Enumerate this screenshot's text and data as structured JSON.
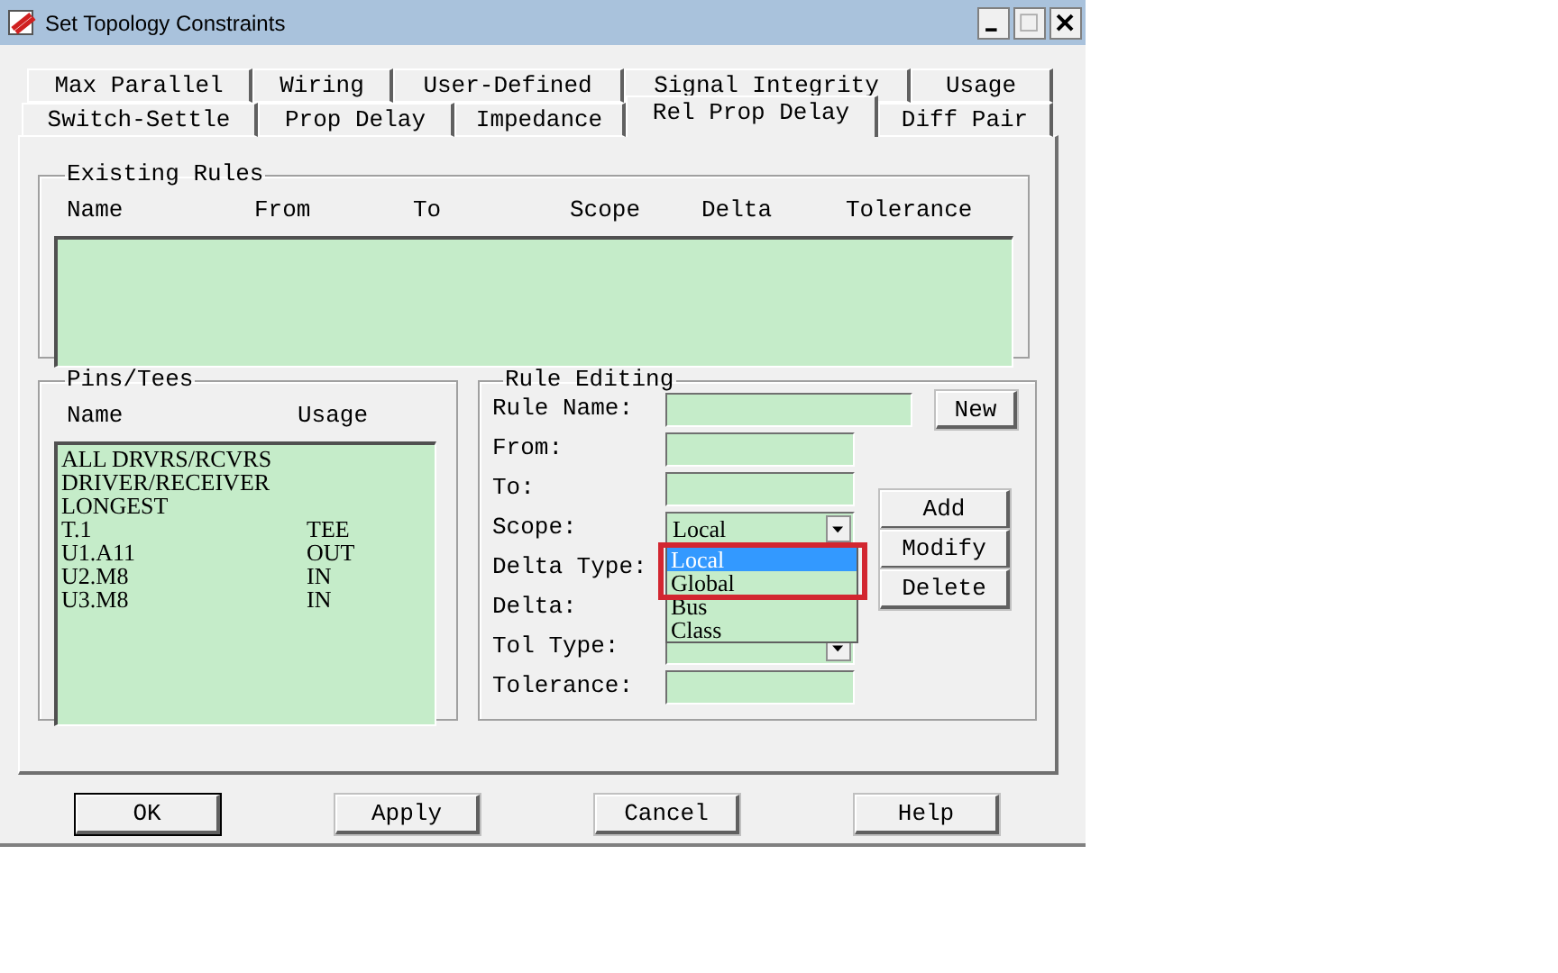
{
  "window": {
    "title": "Set Topology Constraints"
  },
  "tab_rows": [
    {
      "tabs": [
        {
          "label": "Max Parallel",
          "selected": false
        },
        {
          "label": "Wiring",
          "selected": false
        },
        {
          "label": "User-Defined",
          "selected": false
        },
        {
          "label": "Signal Integrity",
          "selected": false
        },
        {
          "label": "Usage",
          "selected": false
        }
      ]
    },
    {
      "tabs": [
        {
          "label": "Switch-Settle",
          "selected": false
        },
        {
          "label": "Prop Delay",
          "selected": false
        },
        {
          "label": "Impedance",
          "selected": false
        },
        {
          "label": "Rel Prop Delay",
          "selected": true
        },
        {
          "label": "Diff Pair",
          "selected": false
        }
      ]
    }
  ],
  "existing_rules": {
    "title": "Existing Rules",
    "columns": [
      "Name",
      "From",
      "To",
      "Scope",
      "Delta",
      "Tolerance"
    ]
  },
  "pins_tees": {
    "title": "Pins/Tees",
    "columns": [
      "Name",
      "Usage"
    ],
    "rows": [
      {
        "name": "ALL DRVRS/RCVRS"
      },
      {
        "name": "DRIVER/RECEIVER"
      },
      {
        "name": "LONGEST"
      },
      {
        "name": "T.1",
        "usage": "TEE"
      },
      {
        "name": "U1.A11",
        "usage": "OUT"
      },
      {
        "name": "U2.M8",
        "usage": "IN"
      },
      {
        "name": "U3.M8",
        "usage": "IN"
      }
    ]
  },
  "rule_editing": {
    "title": "Rule Editing",
    "fields": [
      {
        "label": "Rule Name:",
        "kind": "text"
      },
      {
        "label": "From:",
        "kind": "text"
      },
      {
        "label": "To:",
        "kind": "text"
      },
      {
        "label": "Scope:",
        "kind": "combo",
        "value": "Local",
        "expanded": true,
        "options": [
          {
            "label": "Local",
            "selected": true
          },
          {
            "label": "Global",
            "selected": false
          },
          {
            "label": "Bus",
            "selected": false
          },
          {
            "label": "Class",
            "selected": false
          }
        ]
      },
      {
        "label": "Delta Type:",
        "kind": "covered"
      },
      {
        "label": "Delta:",
        "kind": "covered"
      },
      {
        "label": "Tol Type:",
        "kind": "combo"
      },
      {
        "label": "Tolerance:",
        "kind": "text"
      }
    ],
    "new_button": "New",
    "action_buttons": [
      "Add",
      "Modify",
      "Delete"
    ]
  },
  "buttons": [
    {
      "label": "OK",
      "default": true
    },
    {
      "label": "Apply",
      "default": false
    },
    {
      "label": "Cancel",
      "default": false
    },
    {
      "label": "Help",
      "default": false
    }
  ]
}
